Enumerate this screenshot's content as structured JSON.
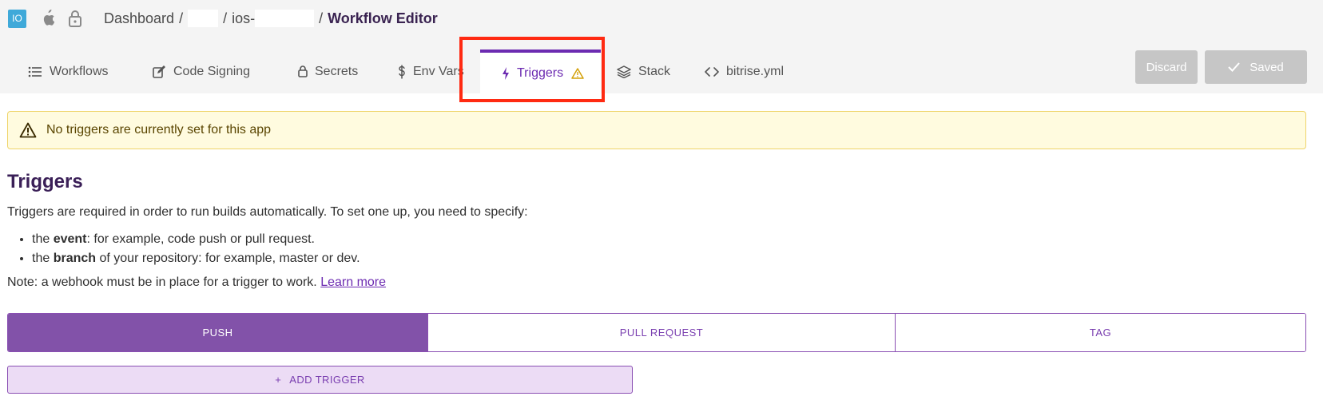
{
  "breadcrumb": {
    "app_badge": "IO",
    "platform_icon": "apple-icon",
    "lock_icon": "lock-icon",
    "dashboard": "Dashboard",
    "separator": "/",
    "project_prefix": "ios-",
    "current": "Workflow Editor"
  },
  "tabs": [
    {
      "label": "Workflows",
      "icon": "list-icon"
    },
    {
      "label": "Code Signing",
      "icon": "edit-icon"
    },
    {
      "label": "Secrets",
      "icon": "lock-icon"
    },
    {
      "label": "Env Vars",
      "icon": "dollar-icon"
    },
    {
      "label": "Triggers",
      "icon": "lightning-icon",
      "badge_icon": "warning-icon",
      "active": true
    },
    {
      "label": "Stack",
      "icon": "layers-icon"
    },
    {
      "label": "bitrise.yml",
      "icon": "code-icon"
    }
  ],
  "actions": {
    "discard": "Discard",
    "saved": "Saved"
  },
  "alert": {
    "text": "No triggers are currently set for this app",
    "icon": "warning-icon"
  },
  "content": {
    "title": "Triggers",
    "intro": "Triggers are required in order to run builds automatically. To set one up, you need to specify:",
    "bullets": [
      {
        "prefix": "the ",
        "bold": "event",
        "suffix": ": for example, code push or pull request."
      },
      {
        "prefix": "the ",
        "bold": "branch",
        "suffix": " of your repository: for example, master or dev."
      }
    ],
    "note": "Note: a webhook must be in place for a trigger to work.",
    "learn_more": "Learn more"
  },
  "trigger_types": [
    {
      "label": "PUSH",
      "active": true
    },
    {
      "label": "PULL REQUEST",
      "active": false
    },
    {
      "label": "TAG",
      "active": false
    }
  ],
  "add_trigger": {
    "plus": "+",
    "label": "ADD TRIGGER"
  },
  "colors": {
    "accent": "#6c2bb1",
    "segment_active": "#8252a9",
    "alert_bg": "#fffbdf",
    "highlight": "#ff2a12"
  }
}
